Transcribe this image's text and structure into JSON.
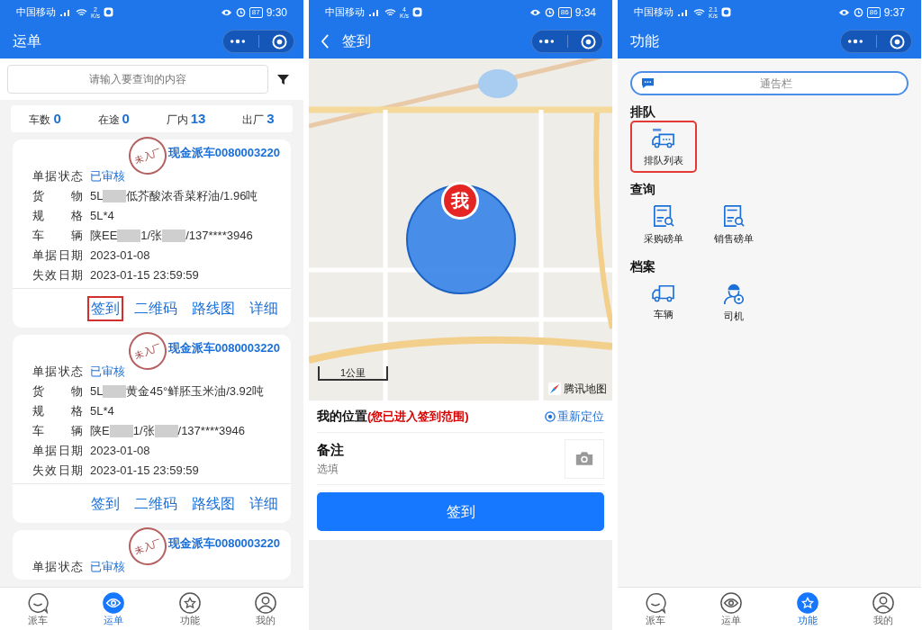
{
  "phones": [
    {
      "kind": "waybills",
      "status_bar": {
        "carrier": "中国移动",
        "speed": "2",
        "speed_unit": "K/s",
        "battery": "87",
        "time": "9:30"
      },
      "title": "运单",
      "search": {
        "placeholder": "请输入要查询的内容"
      },
      "stats": [
        {
          "label": "车数",
          "value": "0"
        },
        {
          "label": "在途",
          "value": "0"
        },
        {
          "label": "厂内",
          "value": "13"
        },
        {
          "label": "出厂",
          "value": "3"
        }
      ],
      "cards": [
        {
          "stamp": "未入厂",
          "title": "现金派车0080003220",
          "fields": [
            {
              "label": "单据状态",
              "kind": "status",
              "value": [
                "已审核"
              ]
            },
            {
              "label": "货物",
              "kind": "plain",
              "value": [
                "5L",
                "低芥酸浓香菜籽油/1.96吨"
              ]
            },
            {
              "label": "规格",
              "kind": "plain",
              "value": [
                "5L*4"
              ]
            },
            {
              "label": "车辆",
              "kind": "plain",
              "value": [
                "陕EE",
                "1/张",
                "/137****3946"
              ]
            },
            {
              "label": "单据日期",
              "kind": "plain",
              "value": [
                "2023-01-08"
              ]
            },
            {
              "label": "失效日期",
              "kind": "plain",
              "value": [
                "2023-01-15 23:59:59"
              ]
            }
          ],
          "actions": [
            {
              "label": "签到",
              "highlighted": true
            },
            {
              "label": "二维码",
              "highlighted": false
            },
            {
              "label": "路线图",
              "highlighted": false
            },
            {
              "label": "详细",
              "highlighted": false
            }
          ]
        },
        {
          "stamp": "未入厂",
          "title": "现金派车0080003220",
          "fields": [
            {
              "label": "单据状态",
              "kind": "status",
              "value": [
                "已审核"
              ]
            },
            {
              "label": "货物",
              "kind": "plain",
              "value": [
                "5L",
                "黄金45°鲜胚玉米油/3.92吨"
              ]
            },
            {
              "label": "规格",
              "kind": "plain",
              "value": [
                "5L*4"
              ]
            },
            {
              "label": "车辆",
              "kind": "plain",
              "value": [
                "陕E",
                "1/张",
                "/137****3946"
              ]
            },
            {
              "label": "单据日期",
              "kind": "plain",
              "value": [
                "2023-01-08"
              ]
            },
            {
              "label": "失效日期",
              "kind": "plain",
              "value": [
                "2023-01-15 23:59:59"
              ]
            }
          ],
          "actions": [
            {
              "label": "签到",
              "highlighted": false
            },
            {
              "label": "二维码",
              "highlighted": false
            },
            {
              "label": "路线图",
              "highlighted": false
            },
            {
              "label": "详细",
              "highlighted": false
            }
          ]
        },
        {
          "stamp": "未入厂",
          "title": "现金派车0080003220",
          "fields": [
            {
              "label": "单据状态",
              "kind": "status",
              "value": [
                "已审核"
              ]
            }
          ]
        }
      ],
      "nav": [
        {
          "label": "派车",
          "kind": "chat",
          "selected": false
        },
        {
          "label": "运单",
          "kind": "eye",
          "selected": true
        },
        {
          "label": "功能",
          "kind": "star",
          "selected": false
        },
        {
          "label": "我的",
          "kind": "person",
          "selected": false
        }
      ]
    },
    {
      "kind": "checkin",
      "status_bar": {
        "carrier": "中国移动",
        "speed": "4",
        "speed_unit": "K/s",
        "battery": "86",
        "time": "9:34"
      },
      "title": "签到",
      "map": {
        "pin": "我",
        "scale": "1公里",
        "attribution": "腾讯地图"
      },
      "location": {
        "label": "我的位置",
        "note": "(您已进入签到范围)",
        "action": "重新定位"
      },
      "remark": {
        "label": "备注",
        "placeholder": "选填"
      },
      "submit": "签到"
    },
    {
      "kind": "functions",
      "status_bar": {
        "carrier": "中国移动",
        "speed": "2.1",
        "speed_unit": "K/s",
        "battery": "86",
        "time": "9:37"
      },
      "title": "功能",
      "notice": "通告栏",
      "sections": [
        {
          "title": "排队",
          "items": [
            {
              "label": "排队列表",
              "kind": "queue",
              "highlighted": true
            }
          ]
        },
        {
          "title": "查询",
          "items": [
            {
              "label": "采购磅单",
              "kind": "doc",
              "highlighted": false
            },
            {
              "label": "销售磅单",
              "kind": "doc",
              "highlighted": false
            }
          ]
        },
        {
          "title": "档案",
          "items": [
            {
              "label": "车辆",
              "kind": "truck",
              "highlighted": false
            },
            {
              "label": "司机",
              "kind": "driver",
              "highlighted": false
            }
          ]
        }
      ],
      "nav": [
        {
          "label": "派车",
          "kind": "chat",
          "selected": false
        },
        {
          "label": "运单",
          "kind": "eye",
          "selected": false
        },
        {
          "label": "功能",
          "kind": "star",
          "selected": true
        },
        {
          "label": "我的",
          "kind": "person",
          "selected": false
        }
      ]
    }
  ]
}
